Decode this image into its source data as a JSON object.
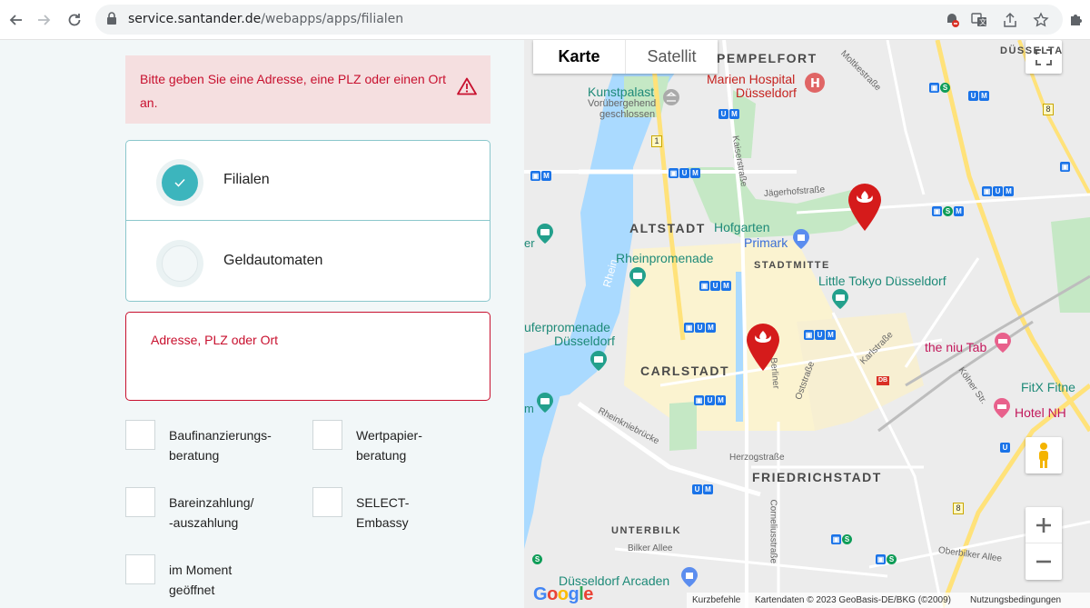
{
  "browser": {
    "url_host": "service.santander.de",
    "url_path": "/webapps/apps/filialen"
  },
  "alert": {
    "text": "Bitte geben Sie eine Adresse, eine PLZ oder einen Ort an."
  },
  "location_type": {
    "options": [
      {
        "label": "Filialen",
        "checked": true
      },
      {
        "label": "Geldautomaten",
        "checked": false
      }
    ]
  },
  "address_field": {
    "placeholder": "Adresse, PLZ oder Ort",
    "value": ""
  },
  "filters": [
    {
      "label_line1": "Baufinanzierungs-",
      "label_line2": "beratung",
      "checked": false
    },
    {
      "label_line1": "Wertpapier-",
      "label_line2": "beratung",
      "checked": false
    },
    {
      "label_line1": "Bareinzahlung/",
      "label_line2": "-auszahlung",
      "checked": false
    },
    {
      "label_line1": "SELECT-",
      "label_line2": "Embassy",
      "checked": false
    },
    {
      "label_line1": "im Moment",
      "label_line2": "geöffnet",
      "checked": false
    }
  ],
  "map": {
    "type_buttons": {
      "map": "Karte",
      "satellite": "Satellit"
    },
    "labels": {
      "pempelfort": "PEMPELFORT",
      "altstadt": "ALTSTADT",
      "stadtmitte": "STADTMITTE",
      "carlstadt": "CARLSTADT",
      "friedrichstadt": "FRIEDRICHSTADT",
      "unterbilk": "UNTERBILK",
      "duesseltal": "DÜSSELTA",
      "kunstpalast": "Kunstpalast",
      "kunstpalast_sub1": "Vorübergehend",
      "kunstpalast_sub2": "geschlossen",
      "marien_hospital1": "Marien Hospital",
      "marien_hospital2": "Düsseldorf",
      "hofgarten": "Hofgarten",
      "primark": "Primark",
      "rheinpromenade": "Rheinpromenade",
      "little_tokyo": "Little Tokyo Düsseldorf",
      "uferpromenade1": "uferpromenade",
      "uferpromenade2": "Düsseldorf",
      "niu_tab": "the niu Tab",
      "fitx": "FitX Fitne",
      "hotel_nh": "Hotel NH",
      "arcaden": "Düsseldorf Arcaden",
      "rhein": "Rhein",
      "er": "er",
      "m": "m",
      "herzogstrasse": "Herzogstraße",
      "bilker_allee": "Bilker Allee",
      "oberbilker_allee": "Oberbilker Allee",
      "kaiserstrasse": "Kaiserstraße",
      "jaegerhofstrasse": "Jägerhofstraße",
      "moltkestrasse": "Moltkestraße",
      "berliner": "Berliner",
      "oststrasse": "Oststraße",
      "karlstrasse": "Karlstraße",
      "koelner_str": "Kölner Str.",
      "corneliusstrasse": "Corneliusstraße",
      "rheinkniebruecke": "Rheinkniebrücke",
      "road_1": "1",
      "road_8a": "8",
      "road_8b": "8",
      "db": "DB"
    },
    "footer": {
      "shortcuts": "Kurzbefehle",
      "attribution": "Kartendaten © 2023 GeoBasis-DE/BKG (©2009)",
      "terms": "Nutzungsbedingungen"
    },
    "google_logo": [
      "G",
      "o",
      "o",
      "g",
      "l",
      "e"
    ],
    "colors": {
      "water": "#aadaff",
      "park": "#c5e8c5",
      "commercial": "#fbf3d0",
      "pin": "#d51b1b"
    }
  },
  "colors": {
    "brand_red": "#c8102e",
    "teal": "#3cb5bd",
    "panel_bg": "#f2f7f8"
  }
}
